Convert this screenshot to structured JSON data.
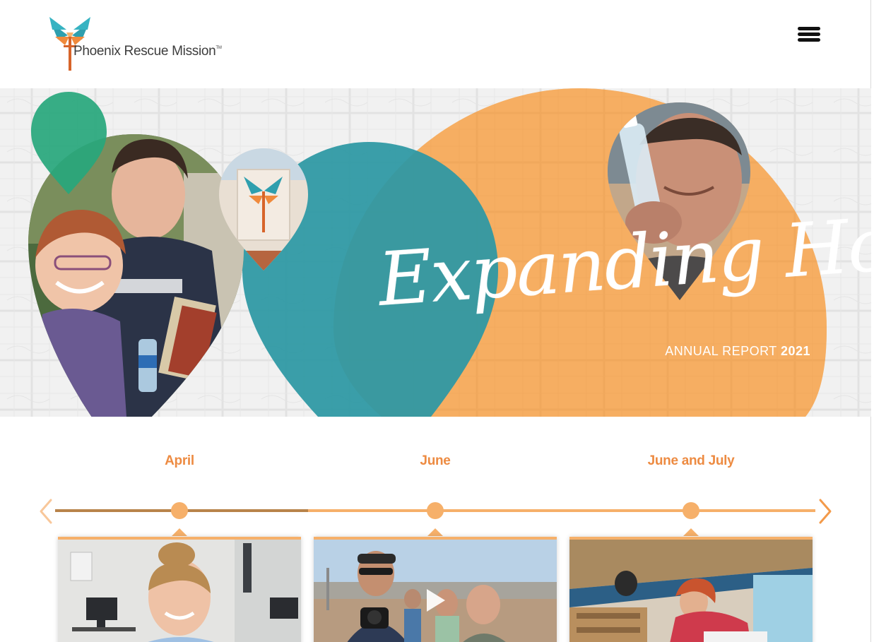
{
  "header": {
    "logo_text": "Phoenix Rescue Mission",
    "logo_tm": "TM",
    "menu_icon": "hamburger-menu-icon"
  },
  "hero": {
    "title": "Expanding Hope",
    "subtitle_prefix": "ANNUAL REPORT",
    "subtitle_year": "2021",
    "colors": {
      "orange": "#f6ae62",
      "teal": "#2e98a4",
      "green": "#27a77c"
    }
  },
  "timeline": {
    "entries": [
      {
        "label": "April",
        "media": "photo"
      },
      {
        "label": "June",
        "media": "video"
      },
      {
        "label": "June and July",
        "media": "photo"
      }
    ],
    "prev_icon": "chevron-left-icon",
    "next_icon": "chevron-right-icon",
    "colors": {
      "accent": "#ed8b42",
      "line_done": "#b8834a",
      "line_todo": "#f6b06a"
    }
  }
}
